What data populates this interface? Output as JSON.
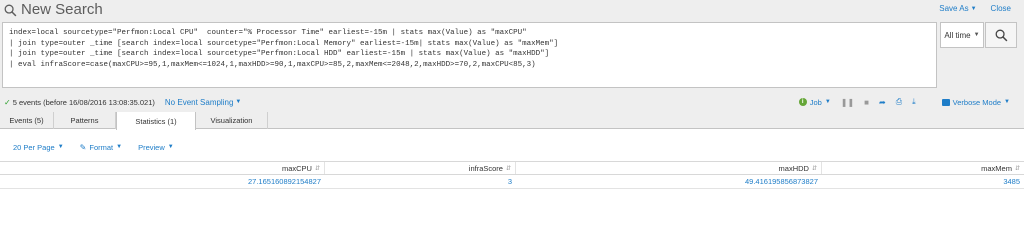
{
  "header": {
    "title": "New Search",
    "save_as_label": "Save As",
    "close_label": "Close"
  },
  "search": {
    "query_lines": [
      "index=local sourcetype=\"Perfmon:Local CPU\"  counter=\"% Processor Time\" earliest=-15m | stats max(Value) as \"maxCPU\"",
      "| join type=outer _time [search index=local sourcetype=\"Perfmon:Local Memory\" earliest=-15m| stats max(Value) as \"maxMem\"]",
      "| join type=outer _time [search index=local sourcetype=\"Perfmon:Local HDD\" earliest=-15m | stats max(Value) as \"maxHDD\"]",
      "| eval infraScore=case(maxCPU>=95,1,maxMem<=1024,1,maxHDD>=90,1,maxCPU>=85,2,maxMem<=2048,2,maxHDD>=70,2,maxCPU<85,3)"
    ],
    "time_range": "All time"
  },
  "status": {
    "events_text": "5 events (before 16/08/2016 13:08:35.021)",
    "sampling_label": "No Event Sampling",
    "job_label": "Job",
    "mode_label": "Verbose Mode"
  },
  "tabs": [
    {
      "label": "Events (5)"
    },
    {
      "label": "Patterns"
    },
    {
      "label": "Statistics (1)"
    },
    {
      "label": "Visualization"
    }
  ],
  "toolbar": {
    "per_page": "20 Per Page",
    "format": "Format",
    "preview": "Preview"
  },
  "table": {
    "columns": [
      "maxCPU",
      "infraScore",
      "maxHDD",
      "maxMem"
    ],
    "rows": [
      [
        "27.165160892154827",
        "3",
        "49.416195856873827",
        "3485"
      ]
    ]
  },
  "colors": {
    "link": "#1e7dc8",
    "chrome": "#eeeeee",
    "success": "#2ea02e",
    "job_icon": "#65a637"
  },
  "icons": {
    "title": "search-icon",
    "search_button": "search-icon",
    "status_check": "checkmark-icon",
    "job": "info-icon",
    "pause": "pause-icon",
    "stop": "stop-icon",
    "share": "share-icon",
    "print": "print-icon",
    "export": "download-icon",
    "mode": "verbose-mode-icon",
    "format": "pencil-icon",
    "sort": "sort-icon"
  }
}
